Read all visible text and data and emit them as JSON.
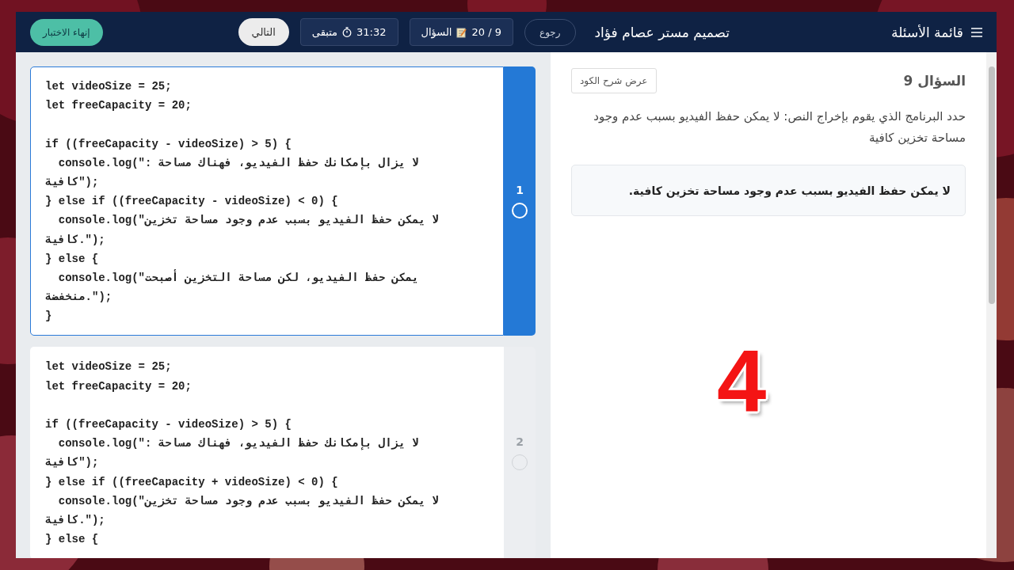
{
  "header": {
    "menu_label": "قائمة الأسئلة",
    "title": "تصميم مستر عصام فؤاد",
    "back_button": "رجوع",
    "question_counter": {
      "value": "9 / 20",
      "label": "السؤال"
    },
    "timer": {
      "value": "31:32",
      "label": "متبقى"
    },
    "next_button": "التالي",
    "finish_button": "إنهاء الاختبار"
  },
  "options": [
    {
      "number": "1",
      "selected": true,
      "code": [
        [
          "let videoSize = 25;",
          "let freeCapacity = 20;"
        ],
        [
          "if ((freeCapacity - videoSize) > 5) {",
          "  console.log(\": لا يزال بإمكانك حفظ الفيديو، فهناك مساحة",
          "كافية\");",
          "} else if ((freeCapacity - videoSize) < 0) {",
          "  console.log(\"لا يمكن حفظ الفيديو بسبب عدم وجود مساحة تخزين",
          "كافية.\");",
          "} else {",
          "  console.log(\"يمكن حفظ الفيديو، لكن مساحة التخزين أصبحت",
          "منخفضة.\");",
          "}"
        ]
      ]
    },
    {
      "number": "2",
      "selected": false,
      "code": [
        [
          "let videoSize = 25;",
          "let freeCapacity = 20;"
        ],
        [
          "if ((freeCapacity - videoSize) > 5) {",
          "  console.log(\": لا يزال بإمكانك حفظ الفيديو، فهناك مساحة",
          "كافية\");",
          "} else if ((freeCapacity + videoSize) < 0) {",
          "  console.log(\"لا يمكن حفظ الفيديو بسبب عدم وجود مساحة تخزين",
          "كافية.\");",
          "} else {"
        ]
      ]
    }
  ],
  "question": {
    "title": "السؤال 9",
    "explain_button": "عرض شرح الكود",
    "text": "حدد البرنامج الذي يقوم بإخراج النص: لا يمكن حفظ الفيديو بسبب عدم وجود مساحة تخزين كافية",
    "expected_output": "لا يمكن حفظ الفيديو بسبب عدم وجود مساحة تخزين كافية."
  },
  "overlay_number": "4"
}
